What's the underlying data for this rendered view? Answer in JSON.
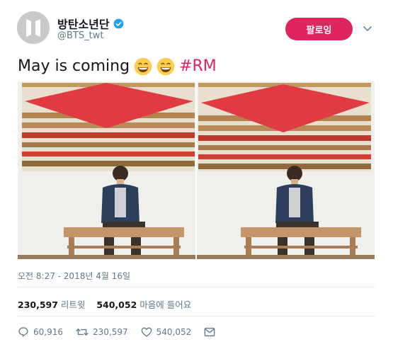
{
  "user": {
    "display_name": "방탄소년단",
    "handle": "@BTS_twt"
  },
  "follow_button": {
    "label": "팔로잉"
  },
  "tweet": {
    "text": "May is coming",
    "emoji": [
      "grinning-face-with-smiling-eyes",
      "grinning-face-with-smiling-eyes"
    ],
    "hashtag": "#RM"
  },
  "photos": [
    {
      "name": "photo-rm-looking-right"
    },
    {
      "name": "photo-rm-smiling"
    }
  ],
  "timestamp": "오전 8:27 - 2018년 4월 16일",
  "stats": {
    "retweet_count": "230,597",
    "retweet_label": "리트윗",
    "like_count": "540,052",
    "like_label": "마음에 들어요"
  },
  "actions": {
    "reply_count": "60,916",
    "retweet_count": "230,597",
    "like_count": "540,052"
  },
  "colors": {
    "accent": "#e0245e",
    "verified": "#1da1f2",
    "muted": "#657786"
  }
}
